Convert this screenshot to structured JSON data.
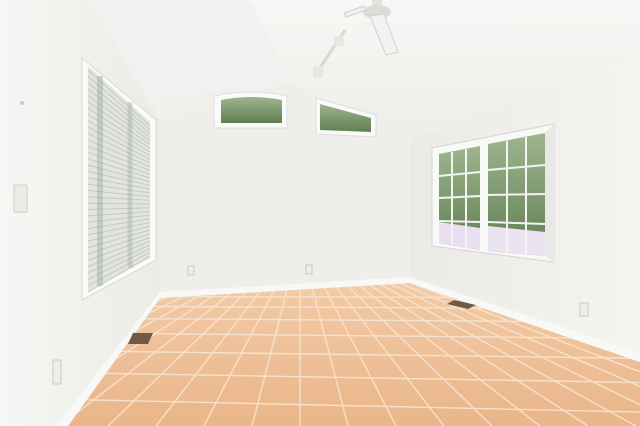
{
  "scene": {
    "description_kind": "photo",
    "colors": {
      "ceiling": "#f3f3f1",
      "wall_left": "#f1f1ee",
      "wall_back": "#efeeea",
      "wall_right": "#f0efec",
      "floor_tile": "#eebc92",
      "grout": "#f4dcc6",
      "baseboard": "#f8f8f6",
      "window_frame": "#f7f7f7",
      "foliage": "#5f7f52",
      "blossom": "#e9dff0"
    },
    "icons": [
      "ceiling-fan-icon",
      "track-light-icon",
      "light-switch-icon",
      "outlet-icon",
      "floor-vent-icon"
    ]
  }
}
